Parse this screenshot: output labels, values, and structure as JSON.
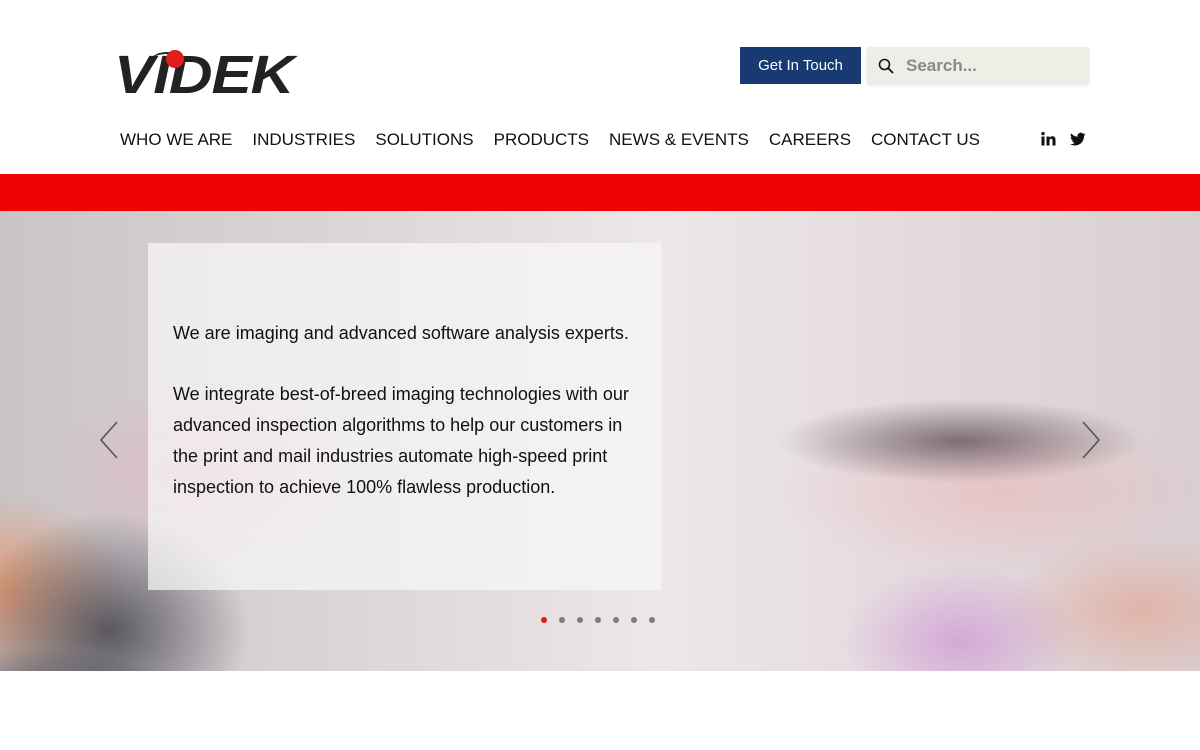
{
  "brand": {
    "logo_text": "VIDEK",
    "accent": "#e21b1b"
  },
  "header": {
    "cta_label": "Get In Touch",
    "search_placeholder": "Search...",
    "nav": [
      "WHO WE ARE",
      "INDUSTRIES",
      "SOLUTIONS",
      "PRODUCTS",
      "NEWS & EVENTS",
      "CAREERS",
      "CONTACT US"
    ],
    "social": [
      "linkedin-icon",
      "twitter-icon"
    ]
  },
  "colors": {
    "band": "#f00303",
    "cta_bg": "#183a73",
    "search_bg": "#efeee6"
  },
  "hero": {
    "paragraphs": [
      "We are imaging and advanced software analysis experts.",
      "We integrate best-of-breed imaging technologies with our advanced inspection algorithms to help our customers in the print and mail industries automate high-speed print inspection to achieve 100% flawless production."
    ],
    "slide_count": 7,
    "active_slide": 1
  }
}
